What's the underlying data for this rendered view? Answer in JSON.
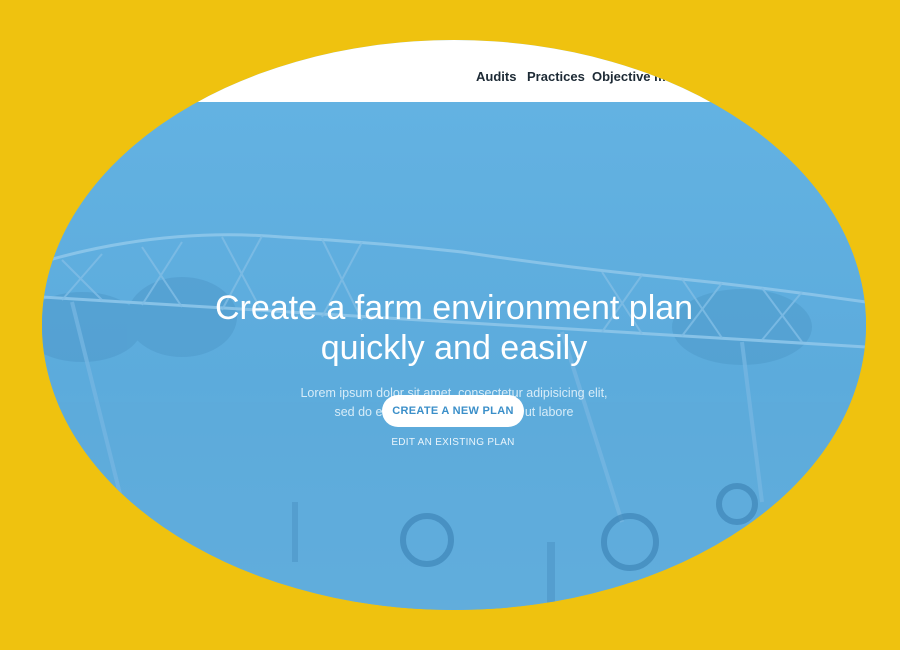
{
  "nav": {
    "items": [
      {
        "label": "Audits"
      },
      {
        "label": "Practices"
      },
      {
        "label": "Objective m"
      }
    ]
  },
  "hero": {
    "headline_line1": "Create a farm environment plan",
    "headline_line2": "quickly and easily",
    "subtext_line1": "Lorem ipsum dolor sit amet, consectetur adipisicing elit,",
    "subtext_line2": "sed do eiusmod tempor incididunt ut labore",
    "cta_label": "CREATE A NEW PLAN",
    "secondary_label": "EDIT AN EXISTING PLAN"
  },
  "colors": {
    "background": "#efc20f",
    "hero_blue": "#62b1e0",
    "nav_bg": "#ffffff",
    "cta_text": "#3b8fc9"
  }
}
